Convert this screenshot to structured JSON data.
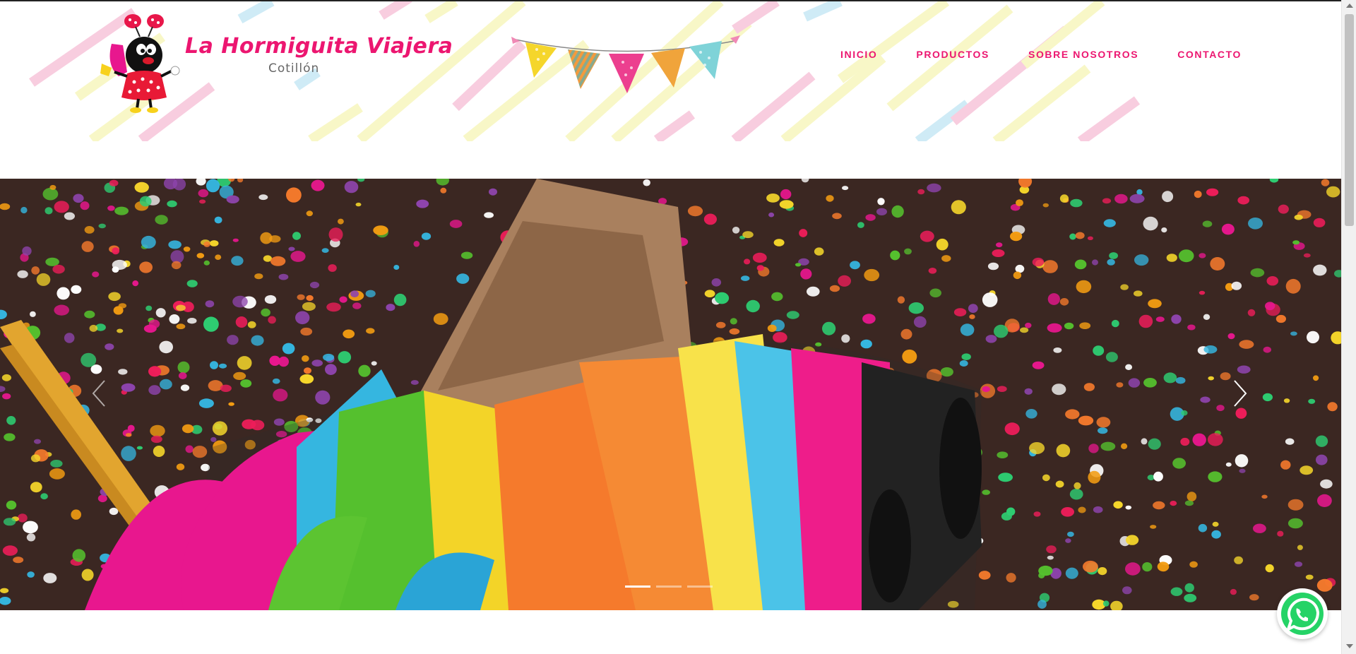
{
  "brand": {
    "name": "La Hormiguita Viajera",
    "subtitle": "Cotillón"
  },
  "nav": {
    "items": [
      {
        "label": "INICIO"
      },
      {
        "label": "PRODUCTOS"
      },
      {
        "label": "SOBRE NOSOTROS"
      },
      {
        "label": "CONTACTO"
      }
    ]
  },
  "carousel": {
    "slide_count": 3,
    "active_slide": 1,
    "prev_icon": "chevron-left-icon",
    "next_icon": "chevron-right-icon"
  },
  "floating": {
    "whatsapp_icon": "whatsapp-icon"
  },
  "colors": {
    "accent": "#ec1670",
    "whatsapp": "#25d366"
  }
}
